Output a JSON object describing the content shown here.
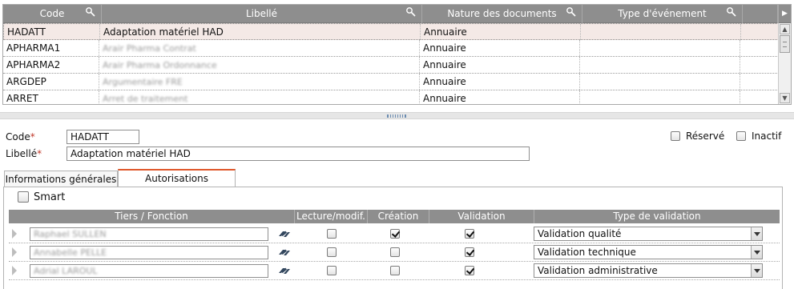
{
  "grid": {
    "columns": [
      {
        "label": "Code"
      },
      {
        "label": "Libellé"
      },
      {
        "label": "Nature des documents"
      },
      {
        "label": "Type d'événement"
      }
    ],
    "rows": [
      {
        "code": "HADATT",
        "libelle": "Adaptation matériel HAD",
        "nature": "Annuaire",
        "type": "",
        "blurred": false
      },
      {
        "code": "APHARMA1",
        "libelle": "Arair Pharma Contrat",
        "nature": "Annuaire",
        "type": "",
        "blurred": true
      },
      {
        "code": "APHARMA2",
        "libelle": "Arair Pharma Ordonnance",
        "nature": "Annuaire",
        "type": "",
        "blurred": true
      },
      {
        "code": "ARGDEP",
        "libelle": "Argumentaire FRE",
        "nature": "Annuaire",
        "type": "",
        "blurred": true
      },
      {
        "code": "ARRET",
        "libelle": "Arret de traitement",
        "nature": "Annuaire",
        "type": "",
        "blurred": true
      }
    ]
  },
  "form": {
    "code_label": "Code",
    "code_value": "HADATT",
    "libelle_label": "Libellé",
    "libelle_value": "Adaptation matériel HAD",
    "reserve_label": "Réservé",
    "inactif_label": "Inactif",
    "required_mark": "*"
  },
  "tabs": [
    {
      "label": "Informations générales",
      "active": false
    },
    {
      "label": "Autorisations",
      "active": true
    }
  ],
  "autorisations": {
    "smart_label": "Smart",
    "smart_checked": false,
    "headers": {
      "tiers": "Tiers / Fonction",
      "lecture": "Lecture/modif.",
      "creation": "Création",
      "validation": "Validation",
      "type_validation": "Type de validation"
    },
    "rows": [
      {
        "tiers": "Raphael SULLEN",
        "lecture": false,
        "creation": true,
        "validation": true,
        "type_validation": "Validation qualité"
      },
      {
        "tiers": "Annabelle PELLE",
        "lecture": false,
        "creation": false,
        "validation": true,
        "type_validation": "Validation technique"
      },
      {
        "tiers": "Adrial LAROUL",
        "lecture": false,
        "creation": false,
        "validation": true,
        "type_validation": "Validation administrative"
      }
    ]
  },
  "colors": {
    "header_bg": "#8e8e8e",
    "selected_row_bg": "#f4e9e6",
    "active_tab_accent": "#e0582b",
    "required_mark": "#c0392b"
  },
  "icons": [
    "filter-icon",
    "column-resize-icon",
    "scroll-right-icon",
    "scroll-up-icon",
    "scroll-down-icon",
    "link-icon",
    "expand-arrow-icon",
    "dropdown-arrow-icon"
  ]
}
